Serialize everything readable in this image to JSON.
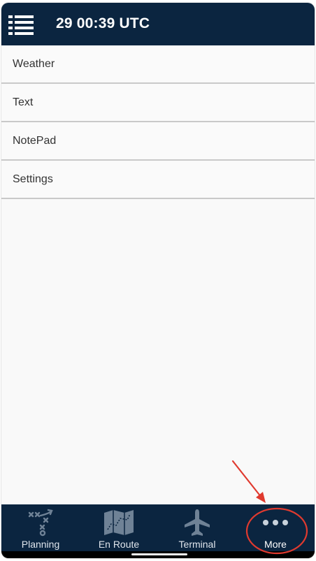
{
  "header": {
    "title": "29 00:39 UTC",
    "menu_icon": "list-menu-icon"
  },
  "menu": {
    "items": [
      {
        "label": "Weather"
      },
      {
        "label": "Text"
      },
      {
        "label": "NotePad"
      },
      {
        "label": "Settings"
      }
    ]
  },
  "tabbar": {
    "tabs": [
      {
        "label": "Planning",
        "icon": "route-plan-icon"
      },
      {
        "label": "En Route",
        "icon": "map-icon"
      },
      {
        "label": "Terminal",
        "icon": "airplane-icon"
      },
      {
        "label": "More",
        "icon": "more-dots-icon",
        "active": true
      }
    ]
  },
  "colors": {
    "header_bg": "#0b2540",
    "tabbar_bg": "#0b2540",
    "annotation": "#e03a2f",
    "icon_muted": "#6f8296"
  }
}
